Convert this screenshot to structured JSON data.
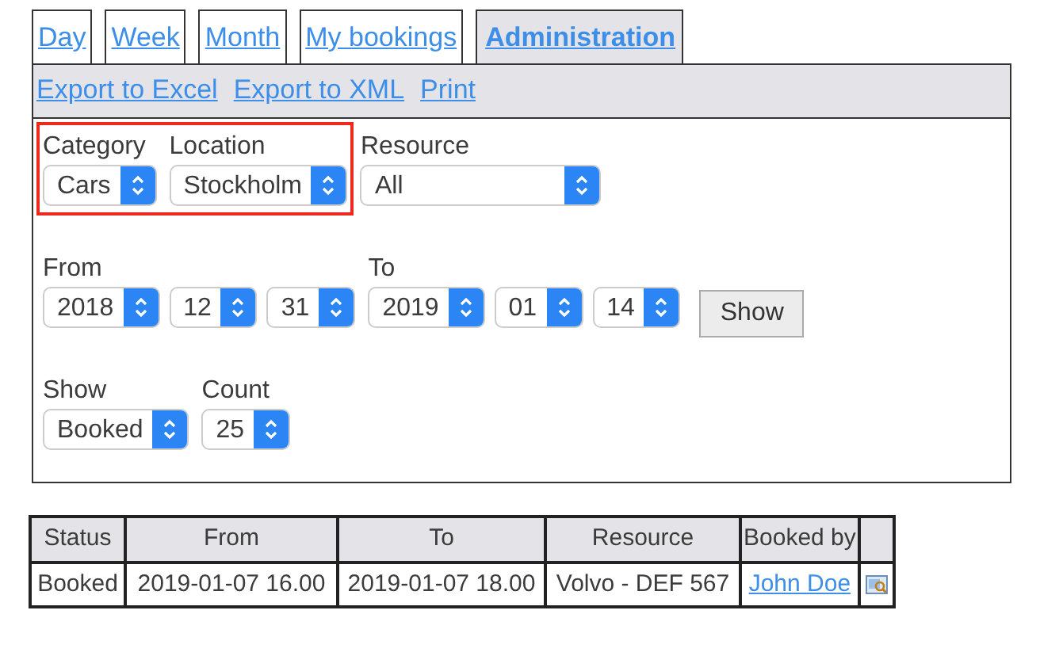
{
  "tabs": [
    {
      "label": "Day",
      "selected": false
    },
    {
      "label": "Week",
      "selected": false
    },
    {
      "label": "Month",
      "selected": false
    },
    {
      "label": "My bookings",
      "selected": false
    },
    {
      "label": "Administration",
      "selected": true
    }
  ],
  "toolbar_links": [
    "Export to Excel",
    "Export to XML",
    "Print"
  ],
  "filter_rows": [
    {
      "groups": [
        {
          "highlighted": true,
          "fields": [
            {
              "label": "Category",
              "values": [
                "Cars"
              ]
            },
            {
              "label": "Location",
              "values": [
                "Stockholm"
              ]
            }
          ]
        },
        {
          "highlighted": false,
          "fields": [
            {
              "label": "Resource",
              "values": [
                "All"
              ],
              "wide": true
            }
          ]
        }
      ]
    },
    {
      "groups": [
        {
          "highlighted": false,
          "fields": [
            {
              "label": "From",
              "values": [
                "2018",
                "12",
                "31"
              ]
            },
            {
              "label": "To",
              "values": [
                "2019",
                "01",
                "14"
              ]
            }
          ]
        }
      ],
      "button": "Show"
    },
    {
      "groups": [
        {
          "highlighted": false,
          "fields": [
            {
              "label": "Show",
              "values": [
                "Booked"
              ]
            },
            {
              "label": "Count",
              "values": [
                "25"
              ]
            }
          ]
        }
      ]
    }
  ],
  "table": {
    "columns": [
      "Status",
      "From",
      "To",
      "Resource",
      "Booked by"
    ],
    "rows": [
      {
        "status": "Booked",
        "from": "2019-01-07 16.00",
        "to": "2019-01-07 18.00",
        "resource": "Volvo - DEF 567",
        "booked_by": "John Doe"
      }
    ]
  }
}
